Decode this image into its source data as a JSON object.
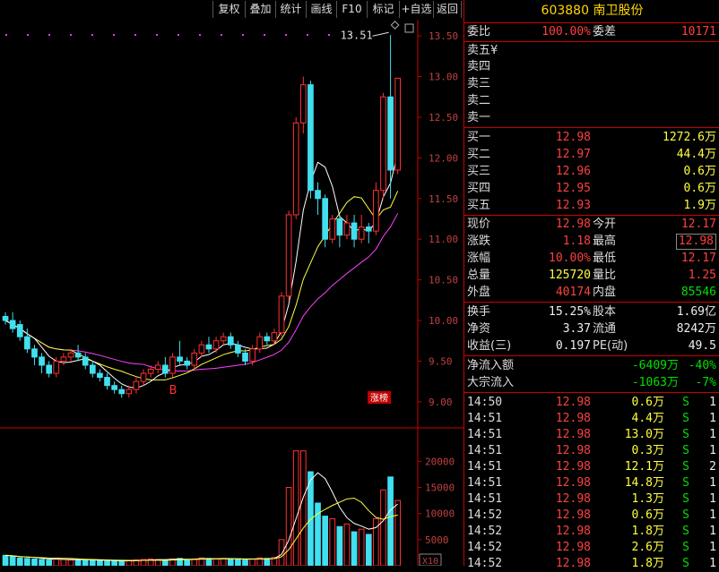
{
  "toolbar": {
    "items": [
      "复权",
      "叠加",
      "统计",
      "画线",
      "F10",
      "标记",
      "+自选",
      "返回"
    ]
  },
  "stock": {
    "code": "603880",
    "name": "南卫股份"
  },
  "order_summary": {
    "wb_label": "委比",
    "wb_value": "100.00%",
    "wc_label": "委差",
    "wc_value": "10171"
  },
  "asks": [
    {
      "label": "卖五¥"
    },
    {
      "label": "卖四"
    },
    {
      "label": "卖三"
    },
    {
      "label": "卖二"
    },
    {
      "label": "卖一"
    }
  ],
  "bids": [
    {
      "label": "买一",
      "price": "12.98",
      "vol": "1272.6万"
    },
    {
      "label": "买二",
      "price": "12.97",
      "vol": "44.4万"
    },
    {
      "label": "买三",
      "price": "12.96",
      "vol": "0.6万"
    },
    {
      "label": "买四",
      "price": "12.95",
      "vol": "0.6万"
    },
    {
      "label": "买五",
      "price": "12.93",
      "vol": "1.9万"
    }
  ],
  "quote": [
    {
      "l1": "现价",
      "v1": "12.98",
      "l2": "今开",
      "v2": "12.17"
    },
    {
      "l1": "涨跌",
      "v1": "1.18",
      "l2": "最高",
      "v2": "12.98"
    },
    {
      "l1": "涨幅",
      "v1": "10.00%",
      "l2": "最低",
      "v2": "12.17"
    },
    {
      "l1": "总量",
      "v1": "125720",
      "l2": "量比",
      "v2": "1.25"
    },
    {
      "l1": "外盘",
      "v1": "40174",
      "l2": "内盘",
      "v2": "85546"
    }
  ],
  "fund": [
    {
      "l1": "换手",
      "v1": "15.25%",
      "l2": "股本",
      "v2": "1.69亿"
    },
    {
      "l1": "净资",
      "v1": "3.37",
      "l2": "流通",
      "v2": "8242万"
    },
    {
      "l1": "收益(三)",
      "v1": "0.197",
      "l2": "PE(动)",
      "v2": "49.5"
    }
  ],
  "flow": [
    {
      "label": "净流入额",
      "v1": "-6409万",
      "v2": "-40%"
    },
    {
      "label": "大宗流入",
      "v1": "-1063万",
      "v2": "-7%"
    }
  ],
  "ticks": [
    {
      "t": "14:50",
      "p": "12.98",
      "v": "0.6万",
      "s": "S",
      "n": "1"
    },
    {
      "t": "14:51",
      "p": "12.98",
      "v": "4.4万",
      "s": "S",
      "n": "1"
    },
    {
      "t": "14:51",
      "p": "12.98",
      "v": "13.0万",
      "s": "S",
      "n": "1"
    },
    {
      "t": "14:51",
      "p": "12.98",
      "v": "0.3万",
      "s": "S",
      "n": "1"
    },
    {
      "t": "14:51",
      "p": "12.98",
      "v": "12.1万",
      "s": "S",
      "n": "2"
    },
    {
      "t": "14:51",
      "p": "12.98",
      "v": "14.8万",
      "s": "S",
      "n": "1"
    },
    {
      "t": "14:51",
      "p": "12.98",
      "v": "1.3万",
      "s": "S",
      "n": "1"
    },
    {
      "t": "14:52",
      "p": "12.98",
      "v": "0.6万",
      "s": "S",
      "n": "1"
    },
    {
      "t": "14:52",
      "p": "12.98",
      "v": "1.8万",
      "s": "S",
      "n": "1"
    },
    {
      "t": "14:52",
      "p": "12.98",
      "v": "2.6万",
      "s": "S",
      "n": "1"
    },
    {
      "t": "14:52",
      "p": "12.98",
      "v": "1.8万",
      "s": "S",
      "n": "1"
    }
  ],
  "chart": {
    "max_label": "13.51",
    "mark_label": "B",
    "badge": "涨榜",
    "vol_unit": "X10",
    "price_ticks": [
      "13.50",
      "13.00",
      "12.50",
      "12.00",
      "11.50",
      "11.00",
      "10.50",
      "10.00",
      "9.50",
      "9.00"
    ],
    "vol_ticks": [
      "20000",
      "15000",
      "10000",
      "5000"
    ],
    "colors": {
      "up": "#ff3030",
      "down": "#40e0f0",
      "ma5": "#ffffff",
      "ma10": "#ffff40",
      "ma20": "#ff40ff"
    }
  },
  "chart_data": {
    "type": "candlestick",
    "ylim": [
      8.8,
      13.7
    ],
    "candles": [
      [
        10.05,
        10.0,
        10.1,
        9.95
      ],
      [
        10.0,
        9.9,
        10.1,
        9.85
      ],
      [
        9.95,
        9.8,
        10.0,
        9.75
      ],
      [
        9.8,
        9.65,
        9.9,
        9.6
      ],
      [
        9.65,
        9.55,
        9.7,
        9.45
      ],
      [
        9.55,
        9.45,
        9.6,
        9.35
      ],
      [
        9.45,
        9.35,
        9.5,
        9.3
      ],
      [
        9.35,
        9.5,
        9.55,
        9.3
      ],
      [
        9.5,
        9.55,
        9.6,
        9.45
      ],
      [
        9.55,
        9.6,
        9.65,
        9.5
      ],
      [
        9.6,
        9.55,
        9.7,
        9.5
      ],
      [
        9.55,
        9.45,
        9.6,
        9.4
      ],
      [
        9.45,
        9.35,
        9.5,
        9.3
      ],
      [
        9.35,
        9.3,
        9.4,
        9.25
      ],
      [
        9.3,
        9.2,
        9.35,
        9.15
      ],
      [
        9.2,
        9.15,
        9.25,
        9.1
      ],
      [
        9.15,
        9.1,
        9.2,
        9.05
      ],
      [
        9.1,
        9.15,
        9.2,
        9.05
      ],
      [
        9.15,
        9.25,
        9.3,
        9.1
      ],
      [
        9.25,
        9.35,
        9.4,
        9.2
      ],
      [
        9.35,
        9.4,
        9.45,
        9.3
      ],
      [
        9.4,
        9.45,
        9.5,
        9.35
      ],
      [
        9.45,
        9.35,
        9.55,
        9.3
      ],
      [
        9.35,
        9.55,
        9.6,
        9.3
      ],
      [
        9.55,
        9.5,
        9.75,
        9.45
      ],
      [
        9.5,
        9.45,
        9.55,
        9.4
      ],
      [
        9.45,
        9.6,
        9.65,
        9.4
      ],
      [
        9.6,
        9.7,
        9.75,
        9.55
      ],
      [
        9.7,
        9.65,
        9.8,
        9.6
      ],
      [
        9.65,
        9.75,
        9.8,
        9.6
      ],
      [
        9.75,
        9.8,
        9.85,
        9.7
      ],
      [
        9.8,
        9.7,
        9.85,
        9.65
      ],
      [
        9.7,
        9.6,
        9.75,
        9.55
      ],
      [
        9.6,
        9.5,
        9.65,
        9.45
      ],
      [
        9.5,
        9.65,
        9.7,
        9.45
      ],
      [
        9.65,
        9.8,
        9.85,
        9.6
      ],
      [
        9.8,
        9.75,
        9.85,
        9.7
      ],
      [
        9.75,
        9.85,
        9.9,
        9.7
      ],
      [
        9.85,
        10.3,
        10.35,
        9.8
      ],
      [
        10.3,
        11.3,
        11.35,
        10.25
      ],
      [
        11.3,
        12.43,
        12.5,
        11.25
      ],
      [
        12.43,
        12.9,
        13.0,
        12.3
      ],
      [
        12.9,
        11.6,
        12.95,
        11.5
      ],
      [
        11.6,
        11.5,
        11.7,
        11.3
      ],
      [
        11.5,
        11.0,
        11.55,
        10.9
      ],
      [
        11.0,
        11.25,
        11.3,
        10.95
      ],
      [
        11.25,
        11.05,
        11.3,
        10.9
      ],
      [
        11.05,
        11.2,
        11.3,
        11.0
      ],
      [
        11.2,
        11.0,
        11.3,
        10.9
      ],
      [
        11.0,
        11.15,
        11.3,
        10.95
      ],
      [
        11.15,
        11.1,
        11.2,
        10.95
      ],
      [
        11.1,
        11.6,
        11.7,
        11.05
      ],
      [
        11.6,
        12.75,
        12.8,
        11.5
      ],
      [
        12.75,
        11.85,
        13.51,
        11.5
      ],
      [
        11.85,
        12.98,
        12.98,
        11.8
      ]
    ],
    "vol": [
      2000,
      1800,
      1500,
      1400,
      1300,
      1200,
      1100,
      1300,
      1200,
      1100,
      1200,
      1100,
      1000,
      1000,
      900,
      900,
      900,
      1000,
      1100,
      1200,
      1300,
      1200,
      1100,
      1300,
      1400,
      1200,
      1300,
      1500,
      1400,
      1300,
      1400,
      1300,
      1200,
      1100,
      1300,
      1500,
      1400,
      1600,
      5000,
      15000,
      22000,
      22000,
      18000,
      12000,
      9500,
      9000,
      7500,
      8000,
      6500,
      7000,
      6000,
      9000,
      14500,
      17000,
      12500
    ]
  }
}
